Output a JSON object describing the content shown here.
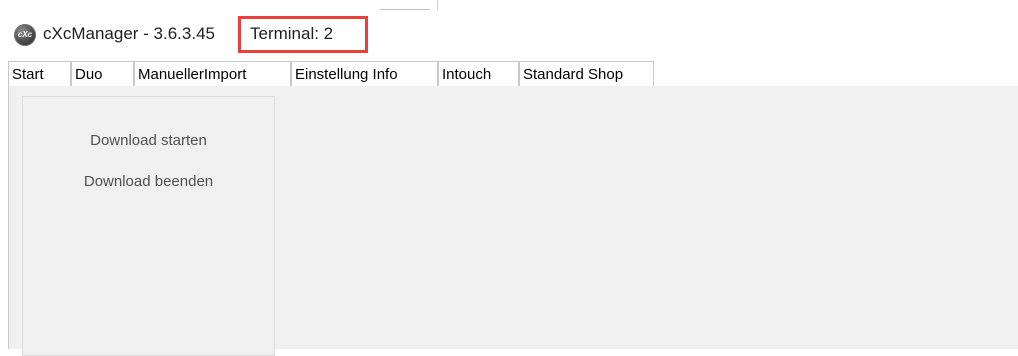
{
  "window": {
    "app_icon_text": "cXc",
    "title": "cXcManager - 3.6.3.45",
    "terminal_label": "Terminal: 2"
  },
  "tabs": [
    {
      "label": "Start"
    },
    {
      "label": "Duo"
    },
    {
      "label": "ManuellerImport"
    },
    {
      "label": "Einstellung Info"
    },
    {
      "label": "Intouch"
    },
    {
      "label": "Standard Shop"
    }
  ],
  "start_panel": {
    "download_start_label": "Download starten",
    "download_end_label": "Download beenden"
  },
  "colors": {
    "highlight_border": "#e8413c",
    "content_background": "#f0f0f0",
    "tab_border": "#c8c8c8"
  }
}
